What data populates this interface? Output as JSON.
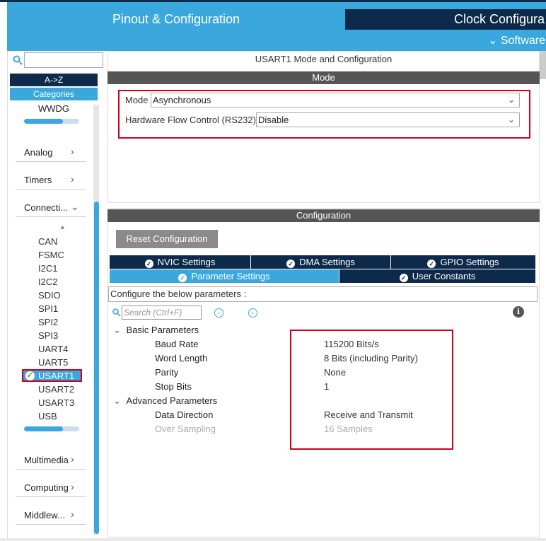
{
  "header": {
    "tab_pinout": "Pinout & Configuration",
    "tab_clock": "Clock Configura",
    "software": "Software"
  },
  "sidebar": {
    "az": "A->Z",
    "categories": "Categories",
    "wwdg": "WWDG",
    "analog": "Analog",
    "timers": "Timers",
    "connectivity": "Connecti...",
    "peripherals": [
      "CAN",
      "FSMC",
      "I2C1",
      "I2C2",
      "SDIO",
      "SPI1",
      "SPI2",
      "SPI3",
      "UART4",
      "UART5",
      "USART1",
      "USART2",
      "USART3",
      "USB"
    ],
    "selected": "USART1",
    "multimedia": "Multimedia",
    "computing": "Computing",
    "middleware": "Middlew...",
    "progress_top": 0.7,
    "progress_bottom": 0.7
  },
  "mode": {
    "title": "USART1 Mode and Configuration",
    "header": "Mode",
    "mode_label": "Mode",
    "mode_value": "Asynchronous",
    "flow_label": "Hardware Flow Control (RS232)",
    "flow_value": "Disable"
  },
  "config": {
    "header": "Configuration",
    "reset": "Reset Configuration",
    "tabs_top": [
      "NVIC Settings",
      "DMA Settings",
      "GPIO Settings"
    ],
    "tab_params": "Parameter Settings",
    "tab_user": "User Constants",
    "configure_text": "Configure the below parameters :",
    "search_placeholder": "Search (Ctrl+F)",
    "basic": "Basic Parameters",
    "advanced": "Advanced Parameters",
    "params": [
      {
        "name": "Baud Rate",
        "value": "115200 Bits/s"
      },
      {
        "name": "Word Length",
        "value": "8 Bits (including Parity)"
      },
      {
        "name": "Parity",
        "value": "None"
      },
      {
        "name": "Stop Bits",
        "value": "1"
      },
      {
        "name": "Data Direction",
        "value": "Receive and Transmit"
      },
      {
        "name": "Over Sampling",
        "value": "16 Samples"
      }
    ]
  }
}
